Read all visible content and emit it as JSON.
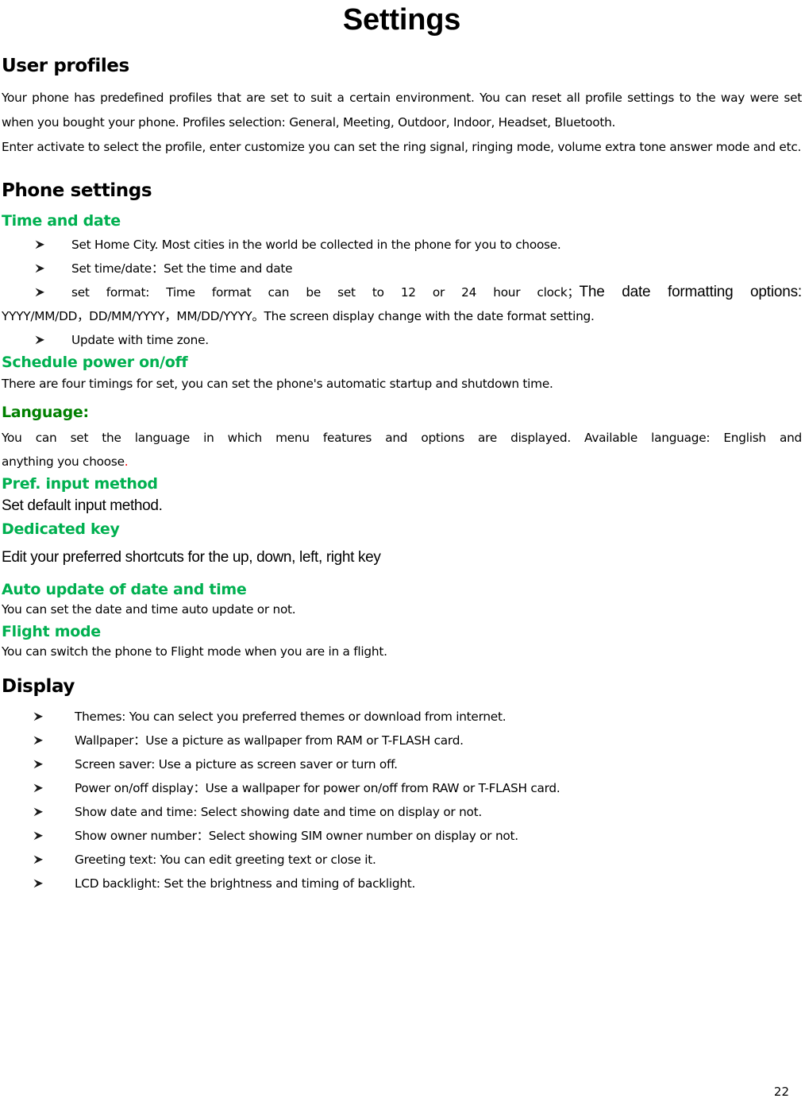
{
  "document": {
    "title": "Settings",
    "page_number": "22"
  },
  "colors": {
    "green_medium": "#00B050",
    "green_dark": "#008000",
    "red": "#FF0000",
    "text": "#000000"
  },
  "icons": {
    "bullet": "arrowhead-bullet"
  },
  "sections": {
    "user_profiles": {
      "heading": "User profiles",
      "paragraph_1": "Your phone has predefined profiles that are set to suit a certain environment. You can reset all profile settings to the way were set when you bought your phone. Profiles selection: General, Meeting, Outdoor, Indoor, Headset, Bluetooth.",
      "paragraph_2": "Enter activate to select the profile, enter customize you can set the ring signal, ringing mode, volume extra tone answer mode and etc."
    },
    "phone_settings": {
      "heading": "Phone settings",
      "time_and_date": {
        "heading": "Time and date",
        "bullets": [
          "Set Home City. Most cities in the world be collected in the phone for you to choose.",
          "Set time/date：Set the time and date",
          "Update with time zone."
        ],
        "set_format_bullet": {
          "part_1": "set format: Time format can be set to 12 or 24 hour clock；",
          "part_2_large": "The date formatting options:",
          "part_3": "YYYY/MM/DD，DD/MM/YYYY，MM/DD/YYYY。The screen display change with the date format setting."
        }
      },
      "schedule_power": {
        "heading": "Schedule power on/off",
        "body": "There are four timings for set, you can set the phone's automatic startup and shutdown time."
      },
      "language": {
        "heading": "Language:",
        "body_line_1": "You can set the language in which menu features and options are displayed. Available language: English and",
        "body_line_2": "anything you choose",
        "body_trailing_period": "."
      },
      "pref_input_method": {
        "heading": "Pref. input method",
        "body": "Set default input method."
      },
      "dedicated_key": {
        "heading": "Dedicated key",
        "body": "Edit your preferred shortcuts for the up, down, left, right key"
      },
      "auto_update": {
        "heading": "Auto update of date and time",
        "body": "You can set the date and time auto update or not."
      },
      "flight_mode": {
        "heading": "Flight mode",
        "body": "You can switch the phone to Flight mode when you are in a flight."
      }
    },
    "display": {
      "heading": "Display",
      "bullets": [
        "Themes: You can select you preferred themes or download from internet.",
        "Wallpaper：Use a picture as wallpaper from RAM or T-FLASH card.",
        "Screen saver: Use a picture as screen saver or turn off.",
        "Power on/off display：Use a wallpaper for power on/off from RAW or T-FLASH card.",
        "Show date and time: Select showing date and time on display or not.",
        "Show owner number：Select showing SIM owner number on display or not.",
        "Greeting text: You can edit greeting text or close it.",
        "LCD backlight: Set the brightness and timing of backlight."
      ]
    }
  }
}
